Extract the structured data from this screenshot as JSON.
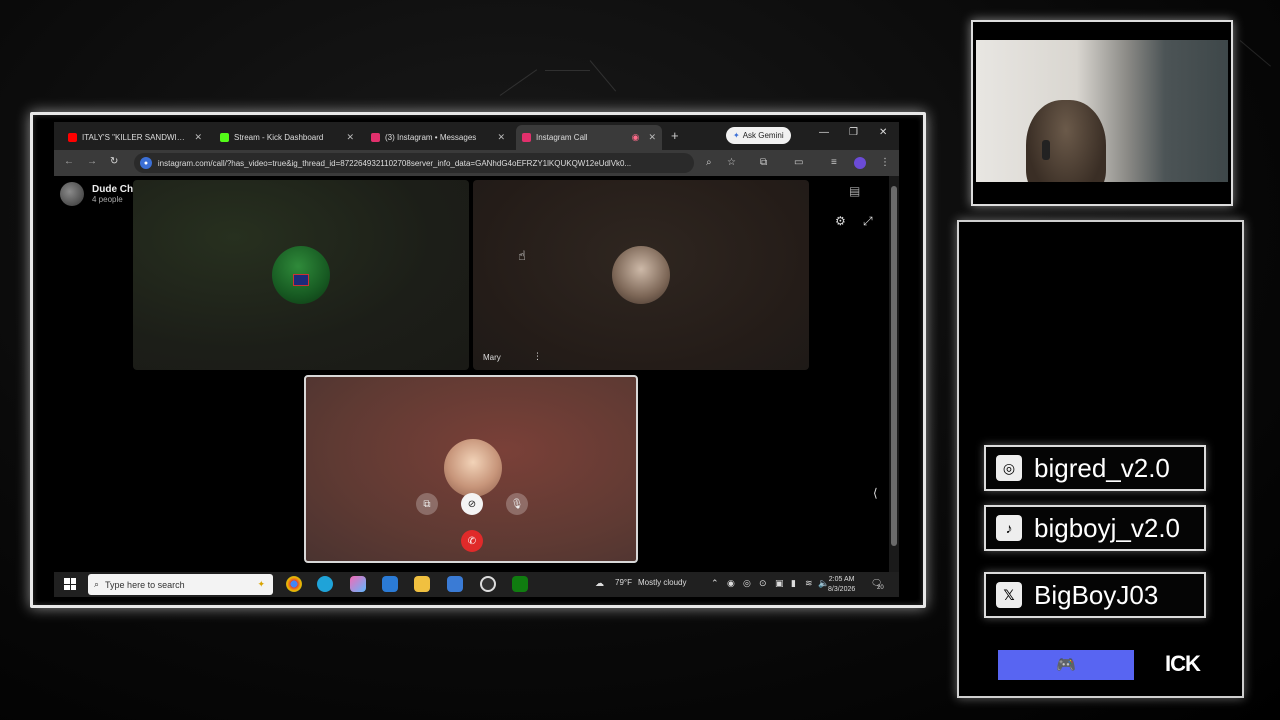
{
  "browser": {
    "tabs": [
      {
        "title": "ITALY'S \"KILLER SANDWICH C",
        "color": "#ff0000"
      },
      {
        "title": "Stream - Kick Dashboard",
        "color": "#53fc18"
      },
      {
        "title": "(3) Instagram • Messages",
        "color": "#e1306c"
      },
      {
        "title": "Instagram Call",
        "color": "#e1306c"
      }
    ],
    "ask_gemini": "Ask Gemini",
    "url": "instagram.com/call/?has_video=true&ig_thread_id=8722649321102708server_info_data=GANhdG4oEFRZY1lKQUKQW12eUdlVk0..."
  },
  "call": {
    "group_name": "Dude Chill Just Chill",
    "group_count": "4 people",
    "participant_name": "Mary"
  },
  "taskbar": {
    "search_placeholder": "Type here to search",
    "weather_temp": "79°F",
    "weather_desc": "Mostly cloudy",
    "time": "2:05 AM",
    "date": "8/3/2026",
    "notification_count": "20"
  },
  "overlay": {
    "instagram": "bigred_v2.0",
    "tiktok": "bigboyj_v2.0",
    "x": "BigBoyJ03",
    "kick": "ICK"
  }
}
